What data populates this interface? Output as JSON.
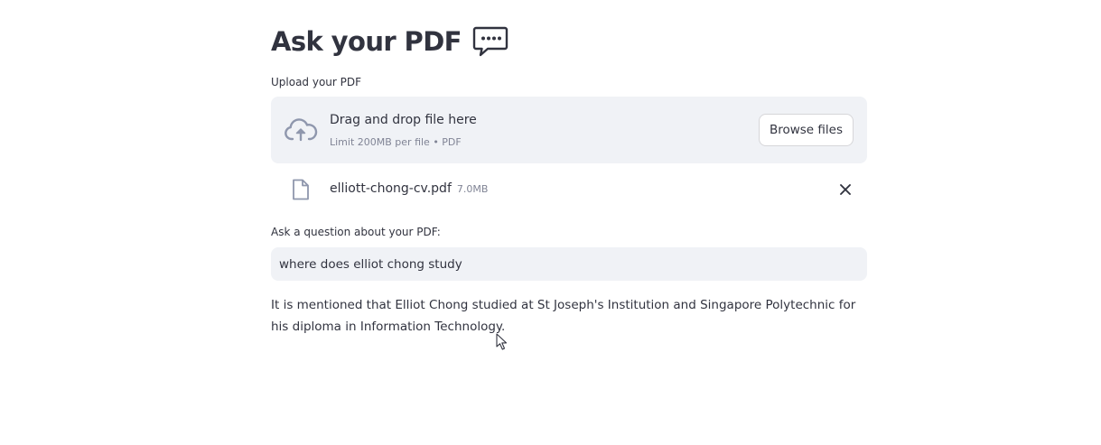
{
  "page": {
    "title": "Ask your PDF",
    "title_icon": "speech-balloon-ellipsis-icon"
  },
  "uploader": {
    "label": "Upload your PDF",
    "drop_text": "Drag and drop file here",
    "limit_text": "Limit 200MB per file • PDF",
    "browse_label": "Browse files",
    "icon": "cloud-upload-icon",
    "uploaded_file": {
      "name": "elliott-chong-cv.pdf",
      "size": "7.0MB",
      "icon": "file-icon",
      "remove_icon": "close-icon"
    }
  },
  "question": {
    "label": "Ask a question about your PDF:",
    "value": "where does elliot chong study"
  },
  "answer": {
    "text": "It is mentioned that Elliot Chong studied at St Joseph's Institution and Singapore Polytechnic for his diploma in Information Technology."
  },
  "colors": {
    "text": "#31333f",
    "muted": "#808495",
    "panel": "#f0f2f6",
    "icon": "#8f97ad"
  }
}
